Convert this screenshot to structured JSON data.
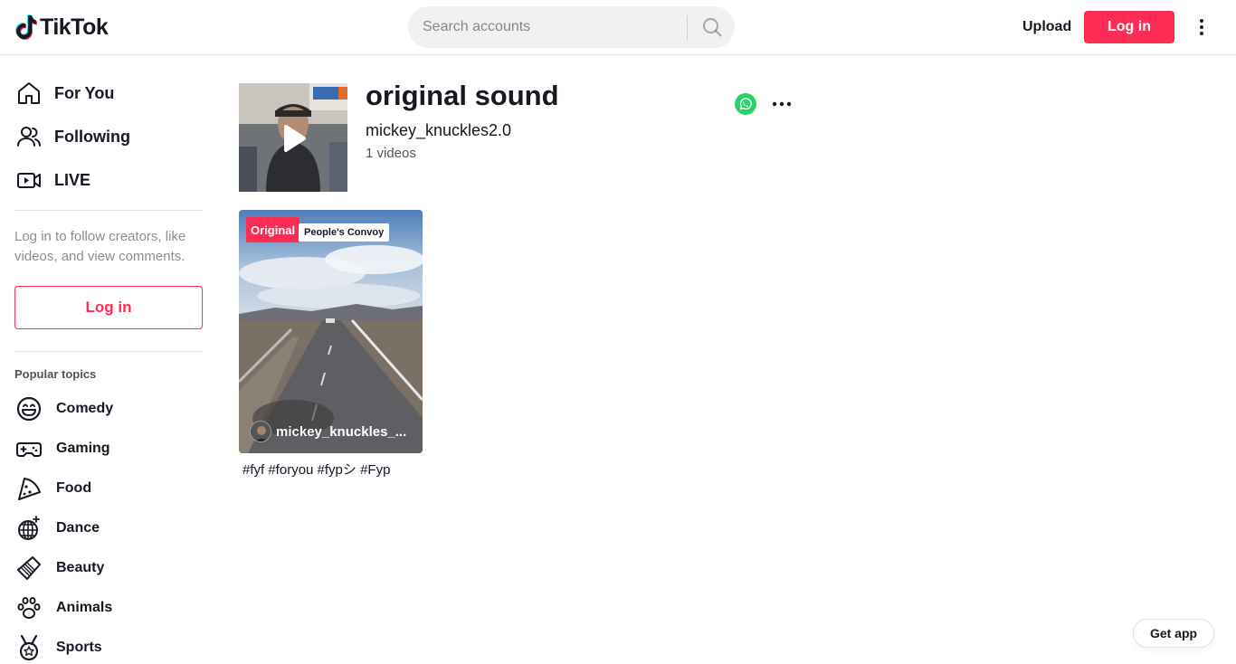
{
  "header": {
    "logo_text": "TikTok",
    "search_placeholder": "Search accounts",
    "upload_label": "Upload",
    "login_label": "Log in",
    "brand_color": "#fe2c55"
  },
  "sidebar": {
    "nav": [
      {
        "label": "For You",
        "icon": "home-icon"
      },
      {
        "label": "Following",
        "icon": "users-icon"
      },
      {
        "label": "LIVE",
        "icon": "live-icon"
      }
    ],
    "login_hint": "Log in to follow creators, like videos, and view comments.",
    "login_button": "Log in",
    "topics_title": "Popular topics",
    "topics": [
      {
        "label": "Comedy",
        "icon": "smile-icon"
      },
      {
        "label": "Gaming",
        "icon": "gamepad-icon"
      },
      {
        "label": "Food",
        "icon": "pizza-icon"
      },
      {
        "label": "Dance",
        "icon": "disco-ball-icon"
      },
      {
        "label": "Beauty",
        "icon": "comb-icon"
      },
      {
        "label": "Animals",
        "icon": "paw-icon"
      },
      {
        "label": "Sports",
        "icon": "medal-icon"
      }
    ]
  },
  "sound": {
    "title": "original sound",
    "author": "mickey_knuckles2.0",
    "count": "1 videos"
  },
  "videos": [
    {
      "badge": "Original",
      "overlay_text": "People's Convoy",
      "author": "mickey_knuckles_...",
      "description": "#fyf #foryou #fypシ #Fyp"
    }
  ],
  "get_app_label": "Get app"
}
